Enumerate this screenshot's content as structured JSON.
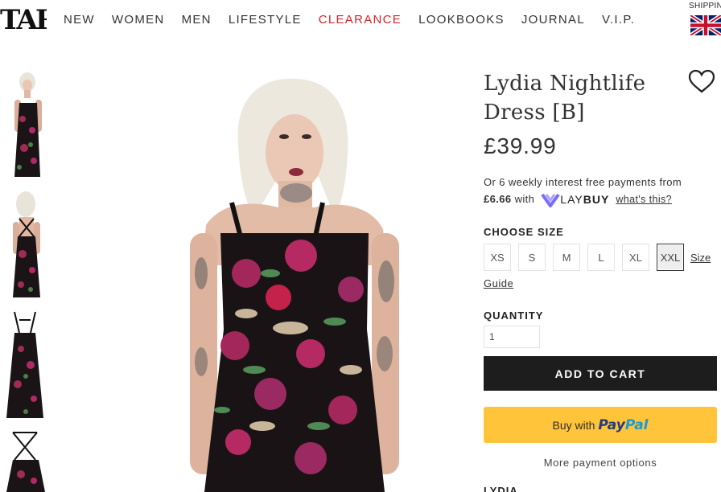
{
  "header": {
    "logo_text": "TAR",
    "nav": [
      "NEW",
      "WOMEN",
      "MEN",
      "LIFESTYLE",
      "CLEARANCE",
      "LOOKBOOKS",
      "JOURNAL",
      "V.I.P."
    ],
    "shipping_label": "SHIPPING",
    "flag": "uk-flag-icon",
    "sale_color": "#d0262a"
  },
  "product": {
    "title": "Lydia Nightlife Dress [B]",
    "price": "£39.99",
    "laybuy": {
      "line1": "Or 6 weekly interest free payments from",
      "amount": "£6.66",
      "with": "with",
      "brand_light": "LAY",
      "brand_bold": "BUY",
      "whats_this": "what's this?",
      "brand_color": "#786dff"
    },
    "size_label": "CHOOSE SIZE",
    "sizes": [
      "XS",
      "S",
      "M",
      "L",
      "XL",
      "XXL"
    ],
    "selected_size": "XXL",
    "size_guide_part1": "Size",
    "size_guide_part2": "Guide",
    "quantity_label": "QUANTITY",
    "quantity_value": "1",
    "add_to_cart": "ADD TO CART",
    "paypal_buy": "Buy with",
    "paypal_pay": "Pay",
    "paypal_pal": "Pal",
    "more_payment": "More payment options",
    "description_heading": "LYDIA."
  }
}
